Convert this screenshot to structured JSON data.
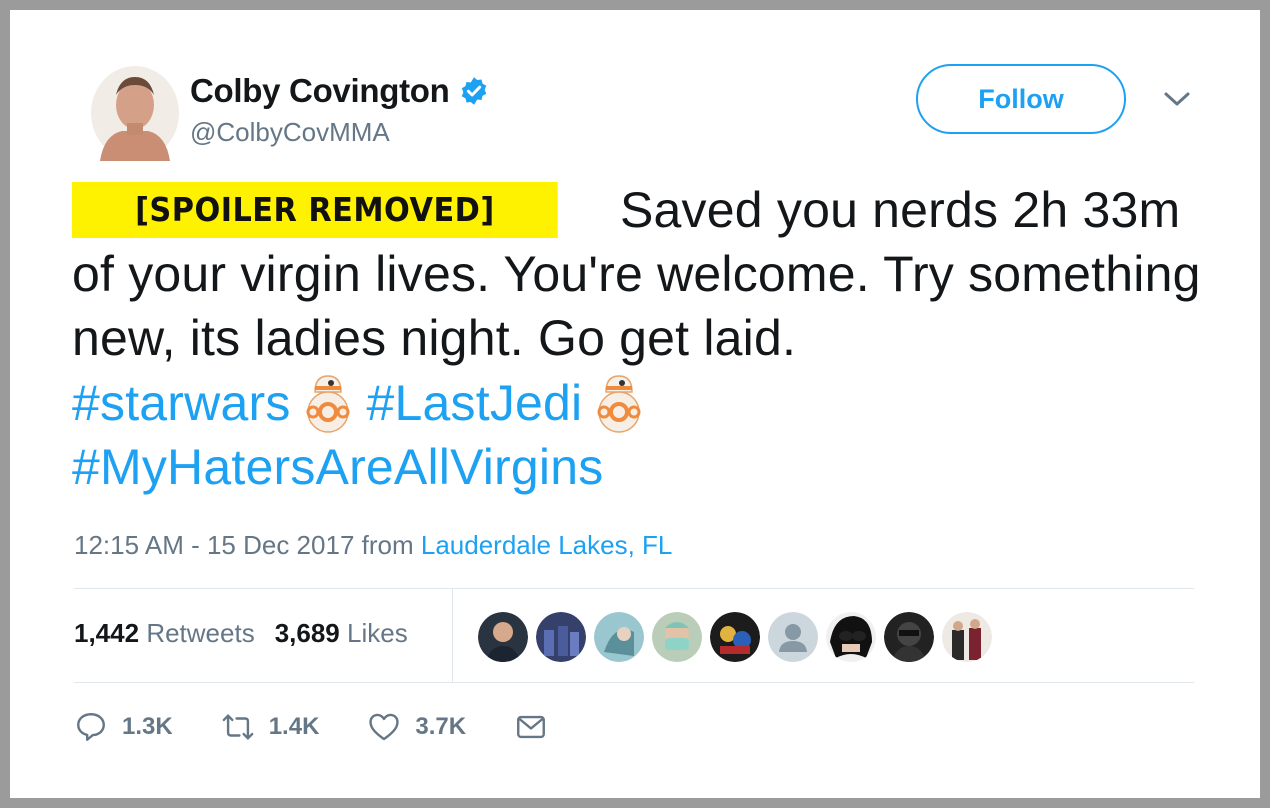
{
  "author": {
    "name": "Colby Covington",
    "handle": "@ColbyCovMMA",
    "verified": true,
    "avatar_icon": "user-avatar-photo"
  },
  "follow_label": "Follow",
  "tweet": {
    "spoiler_label": "[SPOILER REMOVED]",
    "body": "Saved you nerds 2h 33m of your virgin lives. You're welcome. Try something new, its ladies night. Go get laid.",
    "hashtag_1": "#starwars",
    "hashtag_2": "#LastJedi",
    "hashtag_3": "#MyHatersAreAllVirgins",
    "emoji_icon": "bb8-emoji"
  },
  "meta": {
    "timestamp": "12:15 AM - 15 Dec 2017",
    "from": "from",
    "location": "Lauderdale Lakes, FL"
  },
  "stats": {
    "retweets_count": "1,442",
    "retweets_label": "Retweets",
    "likes_count": "3,689",
    "likes_label": "Likes"
  },
  "actions": {
    "reply_count": "1.3K",
    "retweet_count": "1.4K",
    "like_count": "3.7K"
  },
  "colors": {
    "accent": "#1da1f2",
    "muted": "#657786",
    "spoiler_highlight": "#fff200"
  }
}
